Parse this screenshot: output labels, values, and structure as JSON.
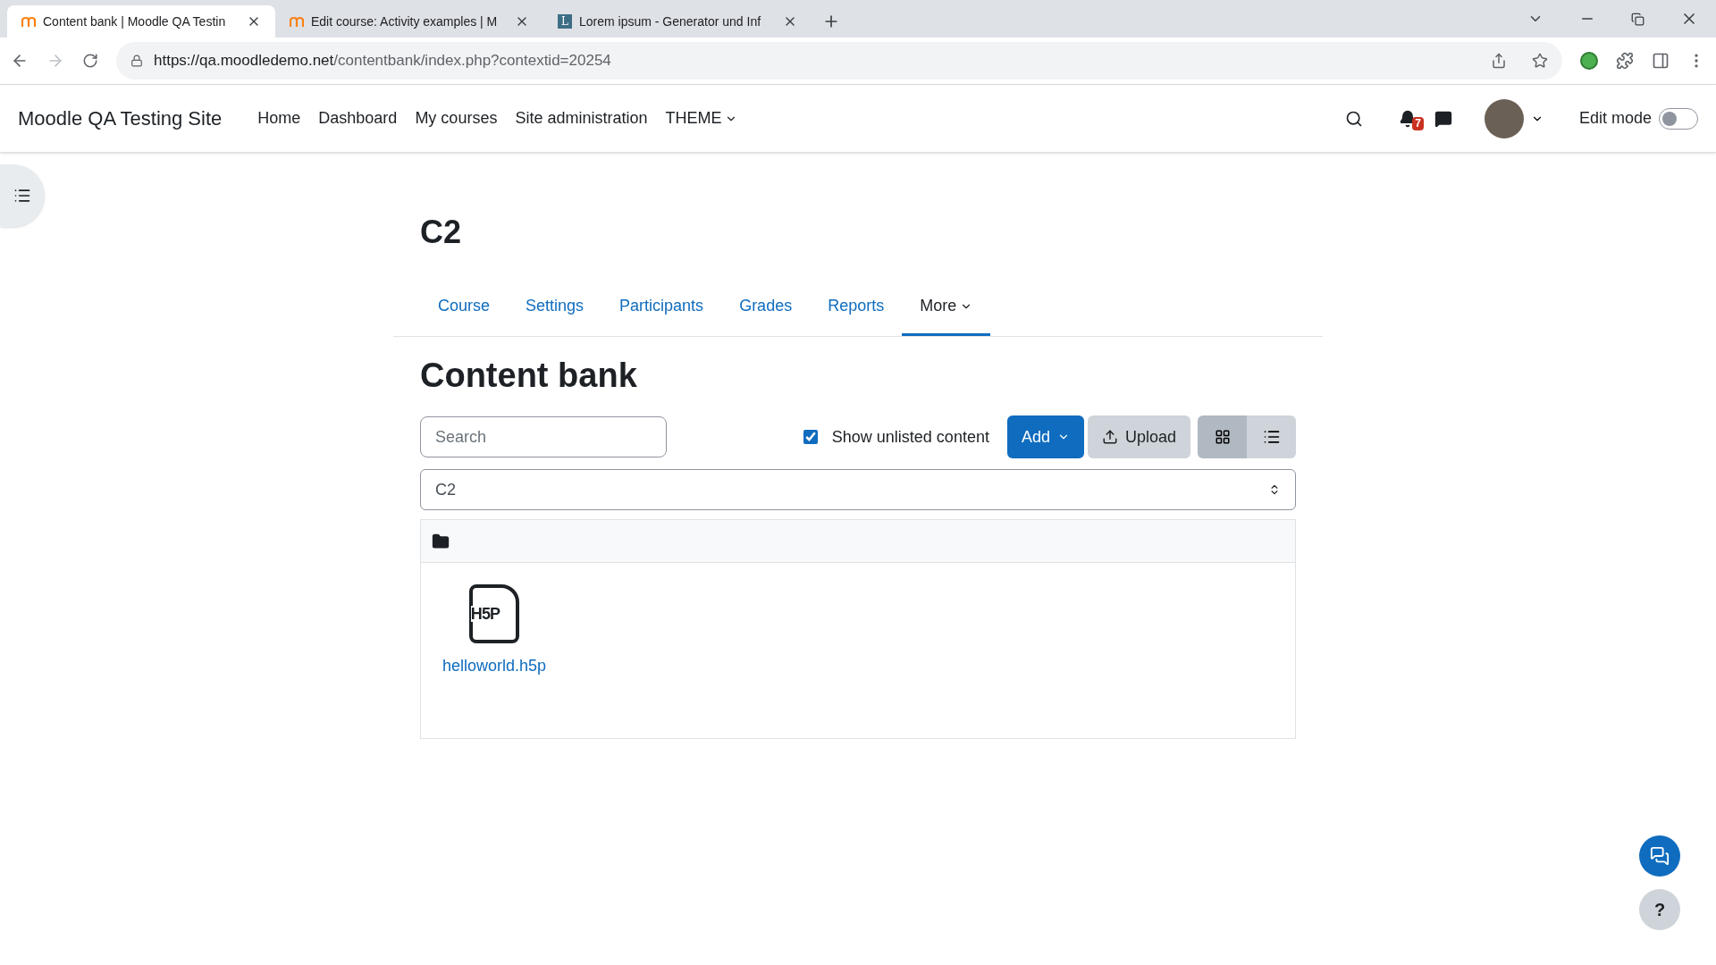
{
  "browser": {
    "tabs": [
      {
        "title": "Content bank | Moodle QA Testin",
        "kind": "moodle",
        "selected": true
      },
      {
        "title": "Edit course: Activity examples | M",
        "kind": "moodle",
        "selected": false
      },
      {
        "title": "Lorem ipsum - Generator und Inf",
        "kind": "letter",
        "selected": false
      }
    ],
    "favicon_letter": "L",
    "url_host": "https://qa.moodledemo.net",
    "url_path": "/contentbank/index.php?contextid=20254"
  },
  "navbar": {
    "site_name": "Moodle QA Testing Site",
    "items": [
      {
        "label": "Home",
        "kind": "link"
      },
      {
        "label": "Dashboard",
        "kind": "link"
      },
      {
        "label": "My courses",
        "kind": "link"
      },
      {
        "label": "Site administration",
        "kind": "link"
      },
      {
        "label": "THEME",
        "kind": "dropdown"
      }
    ],
    "notification_count": "7",
    "edit_mode": {
      "label": "Edit mode",
      "on": false
    }
  },
  "course": {
    "title": "C2",
    "tabs": [
      {
        "label": "Course",
        "kind": "link",
        "selected": false
      },
      {
        "label": "Settings",
        "kind": "link",
        "selected": false
      },
      {
        "label": "Participants",
        "kind": "link",
        "selected": false
      },
      {
        "label": "Grades",
        "kind": "link",
        "selected": false
      },
      {
        "label": "Reports",
        "kind": "link",
        "selected": false
      },
      {
        "label": "More",
        "kind": "dropdown",
        "selected": true
      }
    ]
  },
  "content_bank": {
    "heading": "Content bank",
    "search": {
      "placeholder": "Search"
    },
    "show_unlisted": {
      "label": "Show unlisted content",
      "checked": true
    },
    "add_button": "Add",
    "upload_button": "Upload",
    "views": [
      {
        "kind": "grid",
        "selected": true
      },
      {
        "kind": "list",
        "selected": false
      }
    ],
    "context_select": "C2",
    "files": [
      {
        "name": "helloworld.h5p",
        "icon_label": "H5P"
      }
    ]
  },
  "help_button": "?"
}
